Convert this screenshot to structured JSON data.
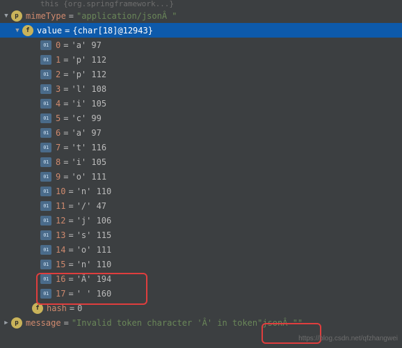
{
  "top_truncated": "this   {org.springframework...}",
  "mimeType": {
    "name": "mimeType",
    "value": "\"application/jsonÂ \""
  },
  "valueField": {
    "name": "value",
    "value": "{char[18]@12943}"
  },
  "items": [
    {
      "idx": "0",
      "ch": "'a' 97"
    },
    {
      "idx": "1",
      "ch": "'p' 112"
    },
    {
      "idx": "2",
      "ch": "'p' 112"
    },
    {
      "idx": "3",
      "ch": "'l' 108"
    },
    {
      "idx": "4",
      "ch": "'i' 105"
    },
    {
      "idx": "5",
      "ch": "'c' 99"
    },
    {
      "idx": "6",
      "ch": "'a' 97"
    },
    {
      "idx": "7",
      "ch": "'t' 116"
    },
    {
      "idx": "8",
      "ch": "'i' 105"
    },
    {
      "idx": "9",
      "ch": "'o' 111"
    },
    {
      "idx": "10",
      "ch": "'n' 110"
    },
    {
      "idx": "11",
      "ch": "'/' 47"
    },
    {
      "idx": "12",
      "ch": "'j' 106"
    },
    {
      "idx": "13",
      "ch": "'s' 115"
    },
    {
      "idx": "14",
      "ch": "'o' 111"
    },
    {
      "idx": "15",
      "ch": "'n' 110"
    },
    {
      "idx": "16",
      "ch": "'Â' 194"
    },
    {
      "idx": "17",
      "ch": "' ' 160"
    }
  ],
  "hashField": {
    "name": "hash",
    "value": "0"
  },
  "message": {
    "name": "message",
    "prefix": "\"Invalid token character 'Â' in token ",
    "highlight": "\"jsonÂ \"\""
  },
  "watermark": "https://blog.csdn.net/qfzhangwei"
}
